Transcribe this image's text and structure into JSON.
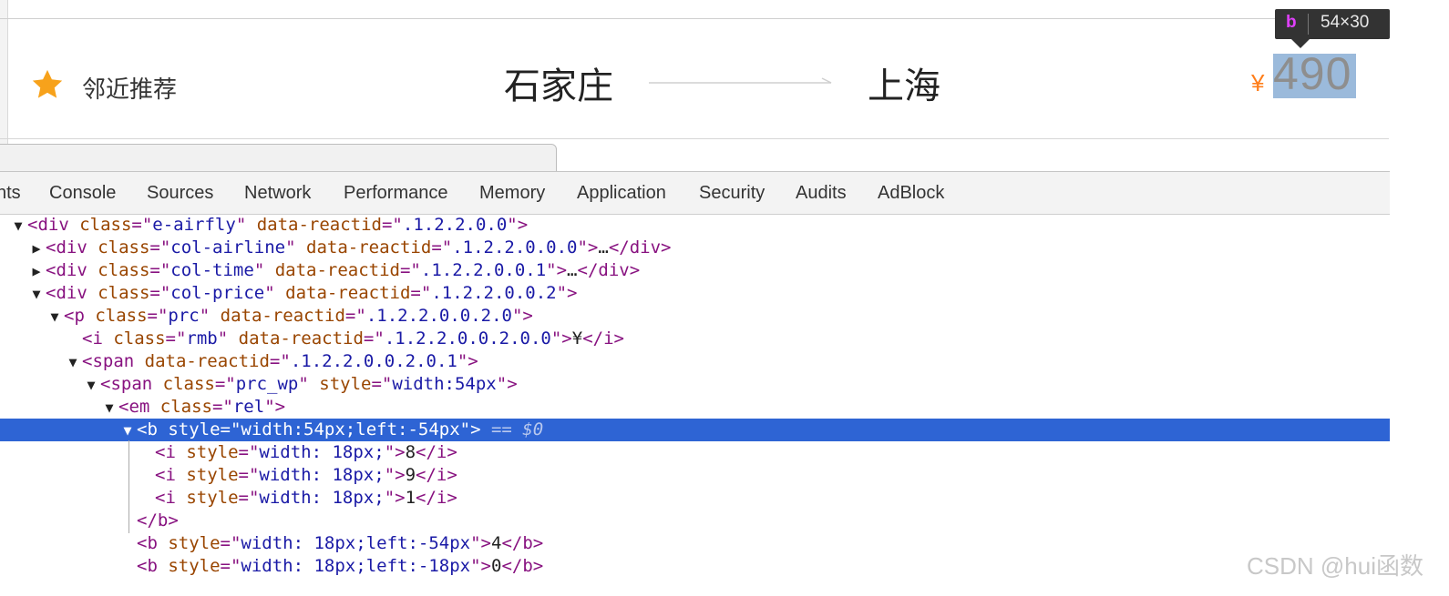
{
  "preview": {
    "recommend_label": "邻近推荐",
    "from_city": "石家庄",
    "to_city": "上海",
    "currency": "¥",
    "price": "490",
    "tooltip_tag": "b",
    "tooltip_size": "54×30",
    "colors": {
      "star": "#f7a21b",
      "currency": "#ff7e1a",
      "highlight": "#9bbadb"
    }
  },
  "devtools": {
    "tabs": [
      "nts",
      "Console",
      "Sources",
      "Network",
      "Performance",
      "Memory",
      "Application",
      "Security",
      "Audits",
      "AdBlock"
    ],
    "selected_suffix": "== $0",
    "lines": [
      {
        "toggle": "▼",
        "parts": [
          [
            "tag",
            "<div "
          ],
          [
            "att",
            "class"
          ],
          [
            "tag",
            "=\""
          ],
          [
            "val",
            "e-airfly"
          ],
          [
            "tag",
            "\" "
          ],
          [
            "att",
            "data-reactid"
          ],
          [
            "tag",
            "=\""
          ],
          [
            "val",
            ".1.2.2.0.0"
          ],
          [
            "tag",
            "\">"
          ]
        ]
      },
      {
        "toggle": "▶",
        "parts": [
          [
            "tag",
            "<div "
          ],
          [
            "att",
            "class"
          ],
          [
            "tag",
            "=\""
          ],
          [
            "val",
            "col-airline"
          ],
          [
            "tag",
            "\" "
          ],
          [
            "att",
            "data-reactid"
          ],
          [
            "tag",
            "=\""
          ],
          [
            "val",
            ".1.2.2.0.0.0"
          ],
          [
            "tag",
            "\">"
          ],
          [
            "txt",
            "…"
          ],
          [
            "tag",
            "</div>"
          ]
        ]
      },
      {
        "toggle": "▶",
        "parts": [
          [
            "tag",
            "<div "
          ],
          [
            "att",
            "class"
          ],
          [
            "tag",
            "=\""
          ],
          [
            "val",
            "col-time"
          ],
          [
            "tag",
            "\" "
          ],
          [
            "att",
            "data-reactid"
          ],
          [
            "tag",
            "=\""
          ],
          [
            "val",
            ".1.2.2.0.0.1"
          ],
          [
            "tag",
            "\">"
          ],
          [
            "txt",
            "…"
          ],
          [
            "tag",
            "</div>"
          ]
        ]
      },
      {
        "toggle": "▼",
        "parts": [
          [
            "tag",
            "<div "
          ],
          [
            "att",
            "class"
          ],
          [
            "tag",
            "=\""
          ],
          [
            "val",
            "col-price"
          ],
          [
            "tag",
            "\" "
          ],
          [
            "att",
            "data-reactid"
          ],
          [
            "tag",
            "=\""
          ],
          [
            "val",
            ".1.2.2.0.0.2"
          ],
          [
            "tag",
            "\">"
          ]
        ]
      },
      {
        "toggle": "▼",
        "parts": [
          [
            "tag",
            "<p "
          ],
          [
            "att",
            "class"
          ],
          [
            "tag",
            "=\""
          ],
          [
            "val",
            "prc"
          ],
          [
            "tag",
            "\" "
          ],
          [
            "att",
            "data-reactid"
          ],
          [
            "tag",
            "=\""
          ],
          [
            "val",
            ".1.2.2.0.0.2.0"
          ],
          [
            "tag",
            "\">"
          ]
        ]
      },
      {
        "toggle": "",
        "parts": [
          [
            "tag",
            "<i "
          ],
          [
            "att",
            "class"
          ],
          [
            "tag",
            "=\""
          ],
          [
            "val",
            "rmb"
          ],
          [
            "tag",
            "\" "
          ],
          [
            "att",
            "data-reactid"
          ],
          [
            "tag",
            "=\""
          ],
          [
            "val",
            ".1.2.2.0.0.2.0.0"
          ],
          [
            "tag",
            "\">"
          ],
          [
            "txt",
            "¥"
          ],
          [
            "tag",
            "</i>"
          ]
        ]
      },
      {
        "toggle": "▼",
        "parts": [
          [
            "tag",
            "<span "
          ],
          [
            "att",
            "data-reactid"
          ],
          [
            "tag",
            "=\""
          ],
          [
            "val",
            ".1.2.2.0.0.2.0.1"
          ],
          [
            "tag",
            "\">"
          ]
        ]
      },
      {
        "toggle": "▼",
        "parts": [
          [
            "tag",
            "<span "
          ],
          [
            "att",
            "class"
          ],
          [
            "tag",
            "=\""
          ],
          [
            "val",
            "prc_wp"
          ],
          [
            "tag",
            "\" "
          ],
          [
            "att",
            "style"
          ],
          [
            "tag",
            "=\""
          ],
          [
            "val",
            "width:54px"
          ],
          [
            "tag",
            "\">"
          ]
        ]
      },
      {
        "toggle": "▼",
        "parts": [
          [
            "tag",
            "<em "
          ],
          [
            "att",
            "class"
          ],
          [
            "tag",
            "=\""
          ],
          [
            "val",
            "rel"
          ],
          [
            "tag",
            "\">"
          ]
        ]
      },
      {
        "toggle": "▼",
        "selected": true,
        "parts": [
          [
            "tag",
            "<b "
          ],
          [
            "att",
            "style"
          ],
          [
            "tag",
            "=\""
          ],
          [
            "val",
            "width:54px;left:-54px"
          ],
          [
            "tag",
            "\">"
          ]
        ]
      },
      {
        "toggle": "",
        "parts": [
          [
            "tag",
            "<i "
          ],
          [
            "att",
            "style"
          ],
          [
            "tag",
            "=\""
          ],
          [
            "val",
            "width: 18px;"
          ],
          [
            "tag",
            "\">"
          ],
          [
            "txt",
            "8"
          ],
          [
            "tag",
            "</i>"
          ]
        ]
      },
      {
        "toggle": "",
        "parts": [
          [
            "tag",
            "<i "
          ],
          [
            "att",
            "style"
          ],
          [
            "tag",
            "=\""
          ],
          [
            "val",
            "width: 18px;"
          ],
          [
            "tag",
            "\">"
          ],
          [
            "txt",
            "9"
          ],
          [
            "tag",
            "</i>"
          ]
        ]
      },
      {
        "toggle": "",
        "parts": [
          [
            "tag",
            "<i "
          ],
          [
            "att",
            "style"
          ],
          [
            "tag",
            "=\""
          ],
          [
            "val",
            "width: 18px;"
          ],
          [
            "tag",
            "\">"
          ],
          [
            "txt",
            "1"
          ],
          [
            "tag",
            "</i>"
          ]
        ]
      },
      {
        "toggle": "",
        "parts": [
          [
            "tag",
            "</b>"
          ]
        ]
      },
      {
        "toggle": "",
        "parts": [
          [
            "tag",
            "<b "
          ],
          [
            "att",
            "style"
          ],
          [
            "tag",
            "=\""
          ],
          [
            "val",
            "width: 18px;left:-54px"
          ],
          [
            "tag",
            "\">"
          ],
          [
            "txt",
            "4"
          ],
          [
            "tag",
            "</b>"
          ]
        ]
      },
      {
        "toggle": "",
        "parts": [
          [
            "tag",
            "<b "
          ],
          [
            "att",
            "style"
          ],
          [
            "tag",
            "=\""
          ],
          [
            "val",
            "width: 18px;left:-18px"
          ],
          [
            "tag",
            "\">"
          ],
          [
            "txt",
            "0"
          ],
          [
            "tag",
            "</b>"
          ]
        ]
      }
    ]
  },
  "watermark": "CSDN @hui函数"
}
